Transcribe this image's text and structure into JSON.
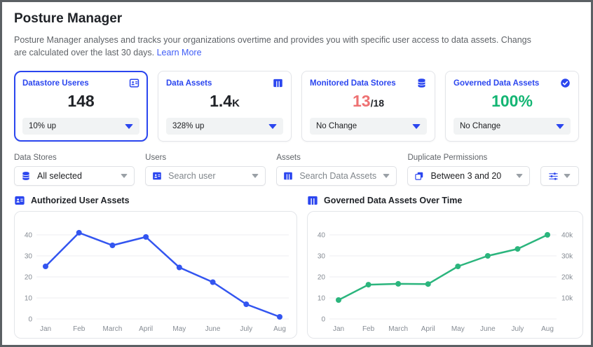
{
  "page": {
    "title": "Posture Manager",
    "description": "Posture Manager analyses and tracks your organizations overtime and provides you with specific user access to data assets. Changs are calculated over the last 30 days.",
    "learn_more_label": "Learn More"
  },
  "stat_cards": [
    {
      "title": "Datastore Useres",
      "icon": "badge-icon",
      "value": "148",
      "suffix": "",
      "footer_label": "10% up",
      "selected": true
    },
    {
      "title": "Data Assets",
      "icon": "columns-icon",
      "value": "1.4",
      "suffix": "K",
      "footer_label": "328% up",
      "selected": false
    },
    {
      "title": "Monitored Data Stores",
      "icon": "database-icon",
      "value": "13",
      "suffix": "/18",
      "footer_label": "No Change",
      "selected": false
    },
    {
      "title": "Governed Data Assets",
      "icon": "check-circle-icon",
      "value": "100%",
      "suffix": "",
      "footer_label": "No Change",
      "selected": false
    }
  ],
  "filters": {
    "data_stores": {
      "label": "Data Stores",
      "value": "All selected",
      "icon": "database-icon"
    },
    "users": {
      "label": "Users",
      "placeholder": "Search user",
      "icon": "badge-icon"
    },
    "assets": {
      "label": "Assets",
      "placeholder": "Search Data Assets",
      "icon": "columns-icon"
    },
    "duplicate_permissions": {
      "label": "Duplicate Permissions",
      "value": "Between 3 and 20",
      "icon": "copy-icon"
    },
    "settings_button_icon": "sliders-icon"
  },
  "colors": {
    "accent_blue": "#2b46ef",
    "chart_blue": "#3355f0",
    "chart_green": "#2bb57d",
    "value_red": "#ee7172",
    "value_green": "#13b573",
    "grid": "#ededf1",
    "tick_text": "#868c94"
  },
  "chart_data": [
    {
      "type": "line",
      "title": "Authorized User Assets",
      "color": "#3355f0",
      "x": [
        "Jan",
        "Feb",
        "March",
        "April",
        "May",
        "June",
        "July",
        "Aug"
      ],
      "values": [
        25,
        41,
        35,
        39,
        24.5,
        17.5,
        7,
        1
      ],
      "ylim": [
        0,
        46
      ],
      "yticks": [
        0,
        10,
        20,
        30,
        40
      ],
      "grid": true,
      "legend": "none",
      "xlabel": "",
      "ylabel": ""
    },
    {
      "type": "line",
      "title": "Governed Data Assets Over Time",
      "color": "#2bb57d",
      "x": [
        "Jan",
        "Feb",
        "March",
        "April",
        "May",
        "June",
        "July",
        "Aug"
      ],
      "values": [
        9,
        16.3,
        16.7,
        16.6,
        25,
        30,
        33.3,
        40
      ],
      "ylim": [
        0,
        46
      ],
      "yticks": [
        0,
        10,
        20,
        30,
        40
      ],
      "right_ticks": {
        "10": "10k",
        "20": "20k",
        "30": "30k",
        "40": "40k"
      },
      "grid": true,
      "legend": "none",
      "xlabel": "",
      "ylabel": ""
    }
  ]
}
